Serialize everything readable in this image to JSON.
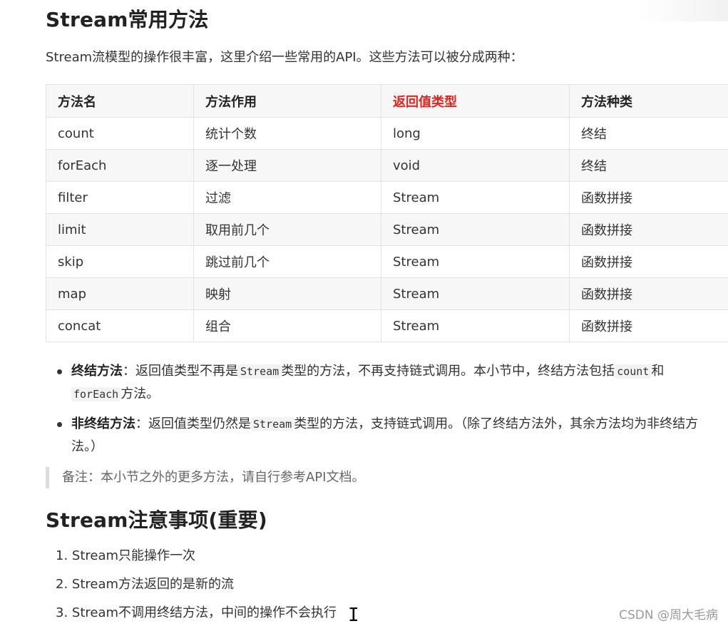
{
  "heading1": "Stream常用方法",
  "intro": "Stream流模型的操作很丰富，这里介绍一些常用的API。这些方法可以被分成两种：",
  "table": {
    "headers": [
      "方法名",
      "方法作用",
      "返回值类型",
      "方法种类"
    ],
    "header_highlight_color": "#e8211b",
    "rows": [
      [
        "count",
        "统计个数",
        "long",
        "终结"
      ],
      [
        "forEach",
        "逐一处理",
        "void",
        "终结"
      ],
      [
        "filter",
        "过滤",
        "Stream",
        "函数拼接"
      ],
      [
        "limit",
        "取用前几个",
        "Stream",
        "函数拼接"
      ],
      [
        "skip",
        "跳过前几个",
        "Stream",
        "函数拼接"
      ],
      [
        "map",
        "映射",
        "Stream",
        "函数拼接"
      ],
      [
        "concat",
        "组合",
        "Stream",
        "函数拼接"
      ]
    ]
  },
  "bullets": [
    {
      "term": "终结方法",
      "t1": "：返回值类型不再是",
      "c1": "Stream",
      "t2": "类型的方法，不再支持链式调用。本小节中，终结方法包括",
      "c2": "count",
      "t3": "和",
      "c3": "forEach",
      "t4": "方法。"
    },
    {
      "term": "非终结方法",
      "t1": "：返回值类型仍然是",
      "c1": "Stream",
      "t2": "类型的方法，支持链式调用。（除了终结方法外，其余方法均为非终结方法。）"
    }
  ],
  "note": "备注：本小节之外的更多方法，请自行参考API文档。",
  "heading2": "Stream注意事项(重要)",
  "ordered_list": [
    "1. Stream只能操作一次",
    "2. Stream方法返回的是新的流",
    "3. Stream不调用终结方法，中间的操作不会执行"
  ],
  "watermark": "CSDN @周大毛病"
}
